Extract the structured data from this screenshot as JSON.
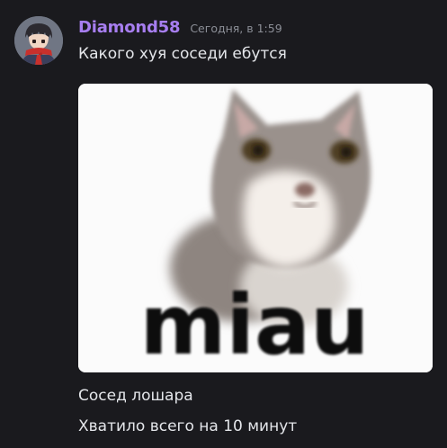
{
  "message": {
    "author": "Diamond58",
    "timestamp": "Сегодня, в 1:59",
    "lines": [
      "Какого хуя соседи ебутся",
      "Сосед лошара",
      "Хватило всего на 10 минут"
    ],
    "attachment": {
      "caption": "miau"
    }
  },
  "colors": {
    "background": "#1a1a1e",
    "username": "#a77ef0",
    "timestamp": "#8b8e96",
    "text": "#e4e6ea"
  },
  "icons": {
    "avatar": "anime-character-avatar"
  }
}
